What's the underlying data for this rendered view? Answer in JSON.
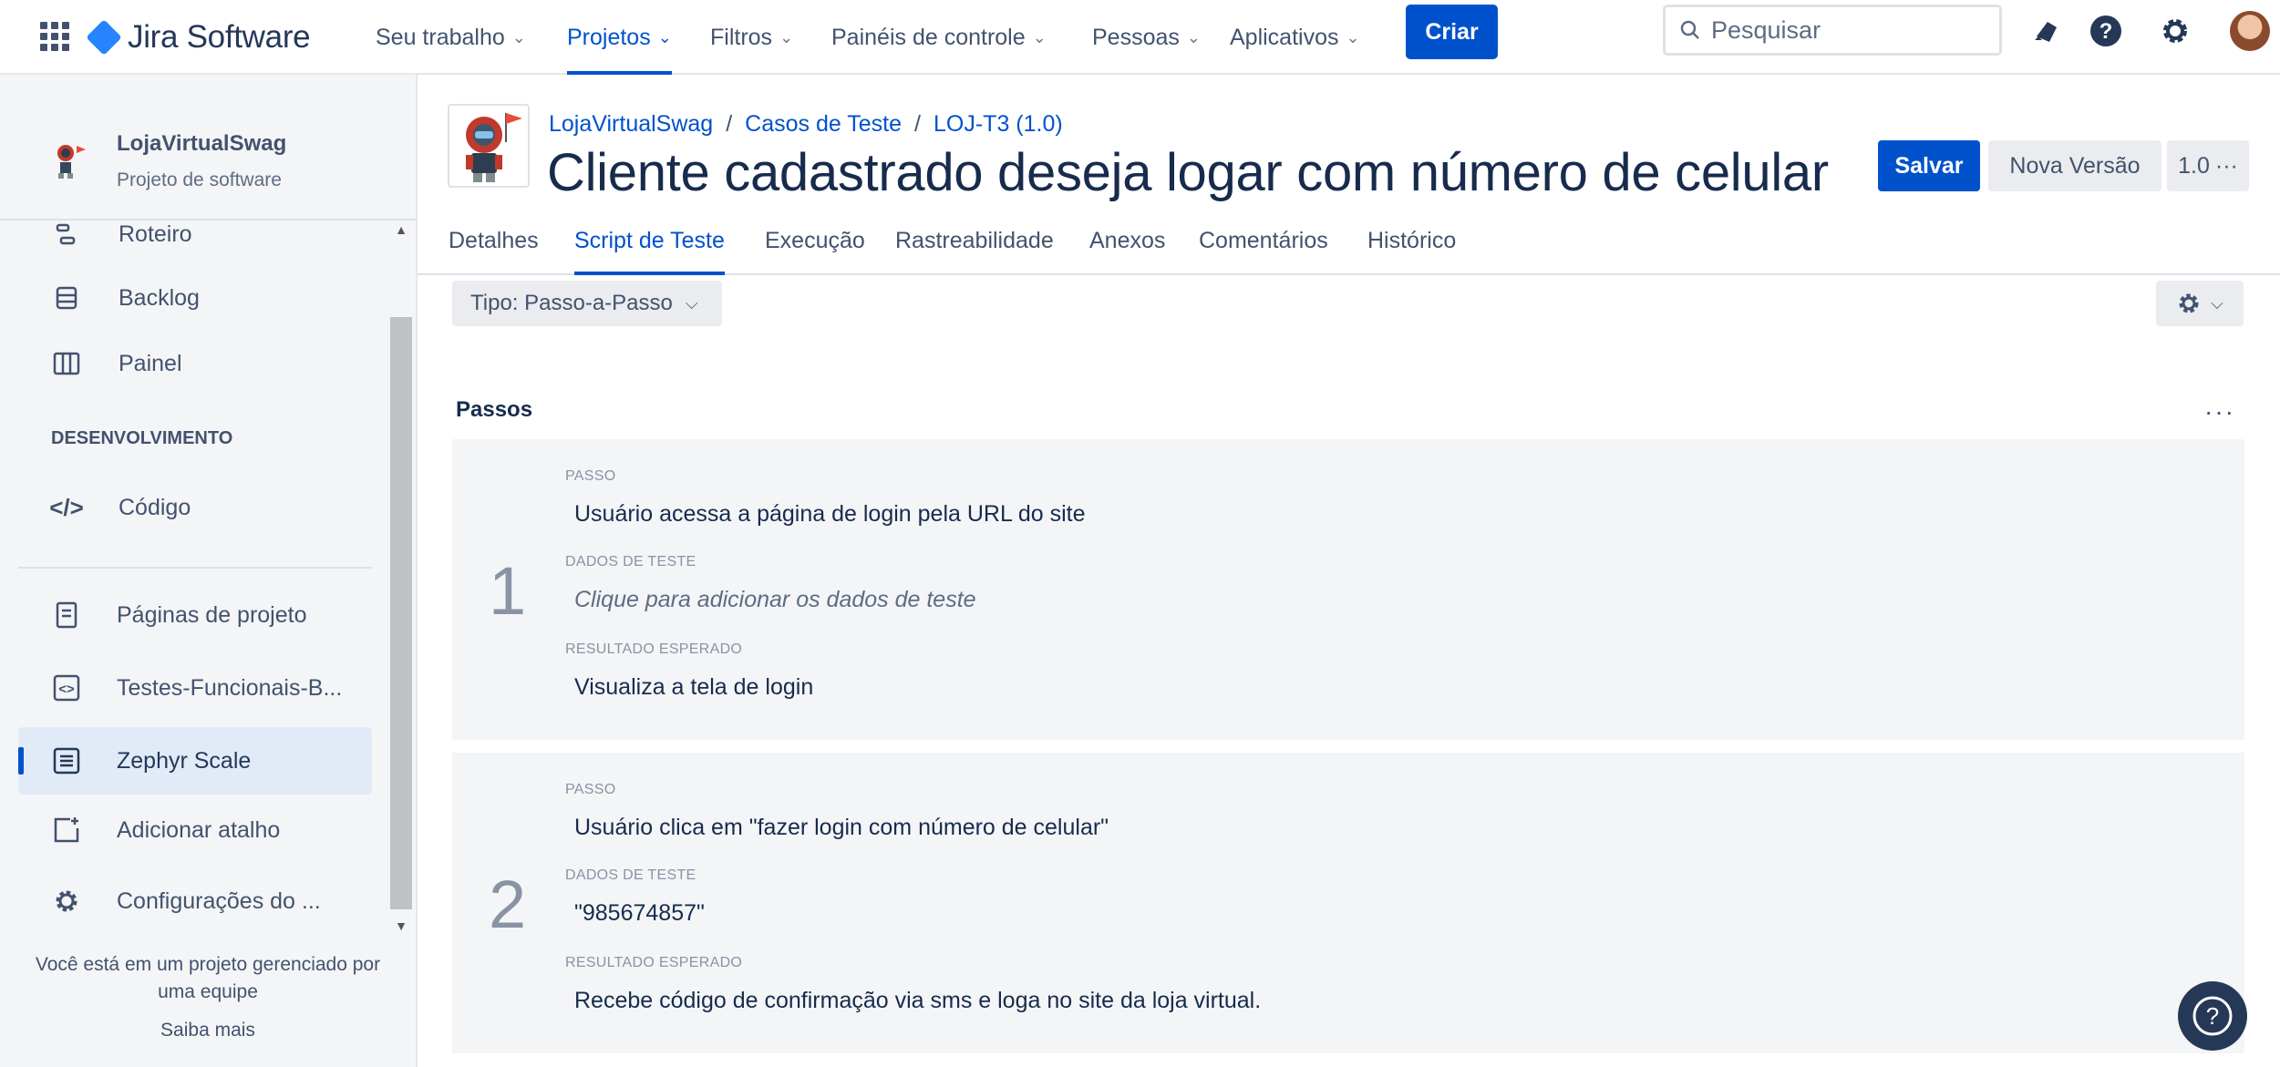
{
  "topnav": {
    "product": "Jira Software",
    "items": [
      {
        "label": "Seu trabalho"
      },
      {
        "label": "Projetos"
      },
      {
        "label": "Filtros"
      },
      {
        "label": "Painéis de controle"
      },
      {
        "label": "Pessoas"
      },
      {
        "label": "Aplicativos"
      }
    ],
    "active_item": "Projetos",
    "create_label": "Criar",
    "search_placeholder": "Pesquisar",
    "icons": [
      "app-switcher-icon",
      "notifications-icon",
      "help-icon",
      "settings-icon",
      "avatar"
    ],
    "accent_color": "#0052cc"
  },
  "sidebar": {
    "project_name": "LojaVirtualSwag",
    "project_type": "Projeto de software",
    "items_top": [
      {
        "label": "Roteiro",
        "icon": "roadmap-icon"
      },
      {
        "label": "Backlog",
        "icon": "backlog-icon"
      },
      {
        "label": "Painel",
        "icon": "board-icon"
      }
    ],
    "section_dev": "DESENVOLVIMENTO",
    "items_dev": [
      {
        "label": "Código",
        "icon": "code-icon"
      }
    ],
    "items_bottom": [
      {
        "label": "Páginas de projeto",
        "icon": "page-icon"
      },
      {
        "label": "Testes-Funcionais-B...",
        "icon": "embed-icon"
      },
      {
        "label": "Zephyr Scale",
        "icon": "zephyr-icon"
      },
      {
        "label": "Adicionar atalho",
        "icon": "add-shortcut-icon"
      },
      {
        "label": "Configurações do ...",
        "icon": "settings-icon"
      }
    ],
    "selected_item": "Zephyr Scale",
    "footer_text": "Você está em um projeto gerenciado por uma equipe",
    "footer_link": "Saiba mais"
  },
  "header": {
    "breadcrumb": [
      "LojaVirtualSwag",
      "Casos de Teste",
      "LOJ-T3 (1.0)"
    ],
    "title": "Cliente cadastrado deseja logar com número de celular",
    "save_label": "Salvar",
    "new_version_label": "Nova Versão",
    "version_label": "1.0",
    "more_label": "···"
  },
  "tabs": [
    {
      "label": "Detalhes"
    },
    {
      "label": "Script de Teste"
    },
    {
      "label": "Execução"
    },
    {
      "label": "Rastreabilidade"
    },
    {
      "label": "Anexos"
    },
    {
      "label": "Comentários"
    },
    {
      "label": "Histórico"
    }
  ],
  "active_tab": "Script de Teste",
  "script": {
    "type_label": "Tipo: Passo-a-Passo",
    "steps_title": "Passos",
    "more_label": "···",
    "field_labels": {
      "step": "PASSO",
      "data": "DADOS DE TESTE",
      "expected": "RESULTADO ESPERADO"
    },
    "steps": [
      {
        "number": "1",
        "step": "Usuário acessa a página de login pela URL do site",
        "data": "Clique para adicionar os dados de teste",
        "data_is_placeholder": true,
        "expected": "Visualiza a tela de login"
      },
      {
        "number": "2",
        "step": "Usuário clica em \"fazer login com número de celular\"",
        "data": "\"985674857\"",
        "data_is_placeholder": false,
        "expected": "Recebe código de confirmação via sms e loga no site da loja virtual."
      }
    ]
  }
}
